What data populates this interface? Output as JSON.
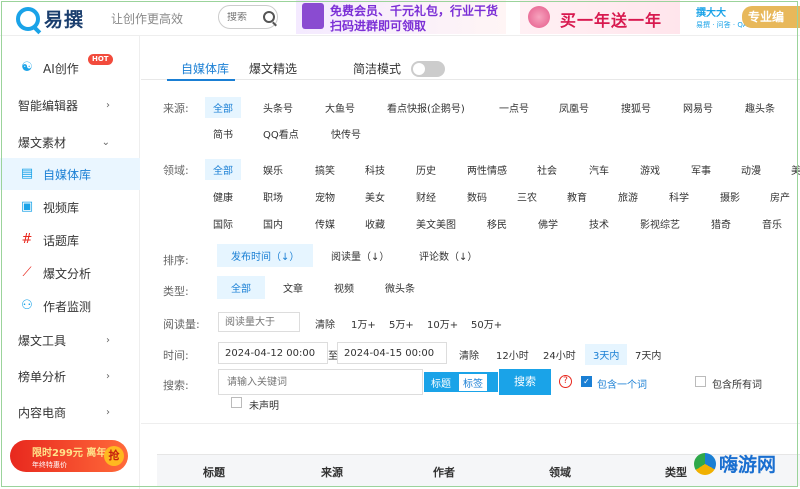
{
  "header": {
    "logo_text": "易撰",
    "slogan": "让创作更高效",
    "search_placeholder": "搜索",
    "ad_member": {
      "line1": "免费会员、千元礼包，行业干货",
      "line2": "扫码进群即可领取"
    },
    "ad_promo": "买一年送一年",
    "ad_brand": {
      "name": "撰大大",
      "sub": "易撰 · 问答 · QA",
      "pro": "专业编"
    }
  },
  "sidebar": {
    "ai": {
      "label": "AI创作",
      "badge": "HOT"
    },
    "editor": {
      "label": "智能编辑器"
    },
    "material": {
      "label": "爆文素材"
    },
    "media_lib": {
      "label": "自媒体库"
    },
    "video_lib": {
      "label": "视频库"
    },
    "topic_lib": {
      "label": "话题库"
    },
    "analysis": {
      "label": "爆文分析"
    },
    "author_monitor": {
      "label": "作者监测"
    },
    "tools": {
      "label": "爆文工具"
    },
    "rank": {
      "label": "榜单分析"
    },
    "ecommerce": {
      "label": "内容电商"
    },
    "promo": {
      "line1": "限时299元 离年",
      "line2": "年终特惠价",
      "badge": "抢"
    }
  },
  "tabs": {
    "media_lib": "自媒体库",
    "hot_select": "爆文精选",
    "simple_mode": "简洁模式"
  },
  "filters": {
    "source_label": "来源:",
    "source_row1": [
      "全部",
      "头条号",
      "大鱼号",
      "看点快报(企鹅号)",
      "一点号",
      "凤凰号",
      "搜狐号",
      "网易号",
      "趣头条"
    ],
    "source_row2": [
      "简书",
      "QQ看点",
      "快传号"
    ],
    "field_label": "领域:",
    "field_row1": [
      "全部",
      "娱乐",
      "搞笑",
      "科技",
      "历史",
      "两性情感",
      "社会",
      "汽车",
      "游戏",
      "军事",
      "动漫",
      "美"
    ],
    "field_row2": [
      "健康",
      "职场",
      "宠物",
      "美女",
      "财经",
      "数码",
      "三农",
      "教育",
      "旅游",
      "科学",
      "摄影",
      "房产"
    ],
    "field_row3": [
      "国际",
      "国内",
      "传媒",
      "收藏",
      "美文美图",
      "移民",
      "佛学",
      "技术",
      "影视综艺",
      "猎奇",
      "音乐"
    ],
    "sort_label": "排序:",
    "sort_options": [
      "发布时间（↓）",
      "阅读量（↓）",
      "评论数（↓）"
    ],
    "type_label": "类型:",
    "type_options": [
      "全部",
      "文章",
      "视频",
      "微头条"
    ],
    "read_label": "阅读量:",
    "read_placeholder": "阅读量大于",
    "read_options": [
      "清除",
      "1万+",
      "5万+",
      "10万+",
      "50万+"
    ],
    "time_label": "时间:",
    "date_start": "2024-04-12 00:00",
    "date_sep": "至",
    "date_end": "2024-04-15 00:00",
    "time_options": [
      "清除",
      "12小时",
      "24小时",
      "3天内",
      "7天内"
    ],
    "search_label": "搜索:",
    "kw_placeholder": "请输入关键词",
    "kw_mode_title": "标题",
    "kw_mode_tag": "标签",
    "search_button": "搜索",
    "help": "?",
    "contain_one": "包含一个词",
    "contain_all": "包含所有词",
    "undeclared": "未声明"
  },
  "table": {
    "headers": [
      "标题",
      "来源",
      "作者",
      "领域",
      "类型"
    ]
  },
  "watermark": {
    "text": "嗨游网"
  }
}
